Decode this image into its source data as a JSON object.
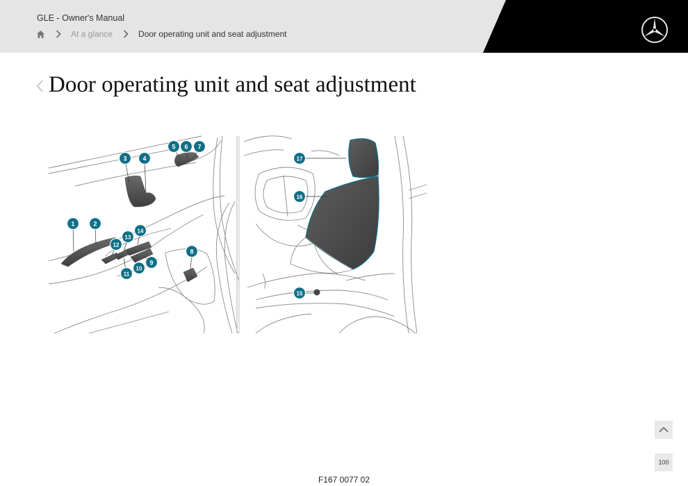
{
  "header": {
    "manual_title": "GLE - Owner's Manual",
    "breadcrumb": [
      {
        "label": "At a glance"
      },
      {
        "label": "Door operating unit and seat adjustment"
      }
    ]
  },
  "page": {
    "title": "Door operating unit and seat adjustment"
  },
  "figure": {
    "code": "F167 0077 02",
    "callouts": [
      "1",
      "2",
      "3",
      "4",
      "5",
      "6",
      "7",
      "8",
      "9",
      "10",
      "11",
      "12",
      "13",
      "14",
      "15",
      "16",
      "17"
    ],
    "accent_color": "#0e6f87"
  },
  "controls": {
    "page_label": "100"
  }
}
